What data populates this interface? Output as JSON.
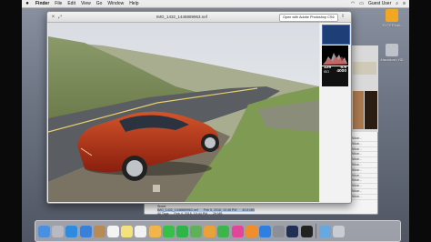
{
  "menubar": {
    "apple": "",
    "items": [
      "Finder",
      "File",
      "Edit",
      "View",
      "Go",
      "Window",
      "Help"
    ],
    "user": "Guest User"
  },
  "desktop": {
    "icons": [
      {
        "label": "EXTERNAL",
        "color": "#f2a723"
      },
      {
        "label": "Macintosh HD",
        "color": "#bfc3c9"
      }
    ]
  },
  "quicklook": {
    "filename": "IMG_1432_1448889963.nef",
    "open_button": "Open with Adobe Photoshop CS6",
    "exif": {
      "aperture_label": "f",
      "shutter": "125",
      "fstop": "5.6",
      "iso_label": "ISO",
      "iso": "4000",
      "mm_label": "18mm"
    }
  },
  "finder": {
    "rows": [
      {
        "name": "Sheet",
        "date": "",
        "size": "",
        "selected": false
      },
      {
        "name": "IMG_1432_1448889963.nef",
        "date": "Feb 5, 2016, 10:46 PM",
        "size": "40.8 MB",
        "selected": true
      },
      {
        "name": "All Tags",
        "date": "Feb 4, 2016, 10:44 PM",
        "size": "29 MB",
        "selected": false
      }
    ],
    "side_items": [
      "Nikon...",
      "Nikon...",
      "Nikon...",
      "Nikon...",
      "Nikon...",
      "Nikon...",
      "Nikon...",
      "Nikon...",
      "Nikon...",
      "Nikon...",
      "Nikon...",
      "Nikon..."
    ]
  },
  "dock": {
    "apps": [
      "finder-icon",
      "launchpad-icon",
      "safari-icon",
      "mail-icon",
      "contacts-icon",
      "calendar-icon",
      "notes-icon",
      "reminders-icon",
      "photos-icon",
      "messages-icon",
      "facetime-icon",
      "maps-icon",
      "pages-icon",
      "numbers-icon",
      "itunes-icon",
      "ibooks-icon",
      "appstore-icon",
      "preferences-icon",
      "photoshop-icon",
      "terminal-icon",
      "folder-icon",
      "trash-icon"
    ],
    "colors": [
      "#4a8fe0",
      "#b9b9c1",
      "#2f8be0",
      "#3a7fd8",
      "#b88a56",
      "#f4f4f4",
      "#f6e27a",
      "#f2f2f2",
      "#f0b64c",
      "#36c04a",
      "#2fb44a",
      "#5fb05a",
      "#e9a23a",
      "#3cb54a",
      "#e2459a",
      "#ef8e2a",
      "#2f7fe0",
      "#8a8f98",
      "#1f2f55",
      "#222222",
      "#68a8e0",
      "#c9cdd3"
    ]
  }
}
